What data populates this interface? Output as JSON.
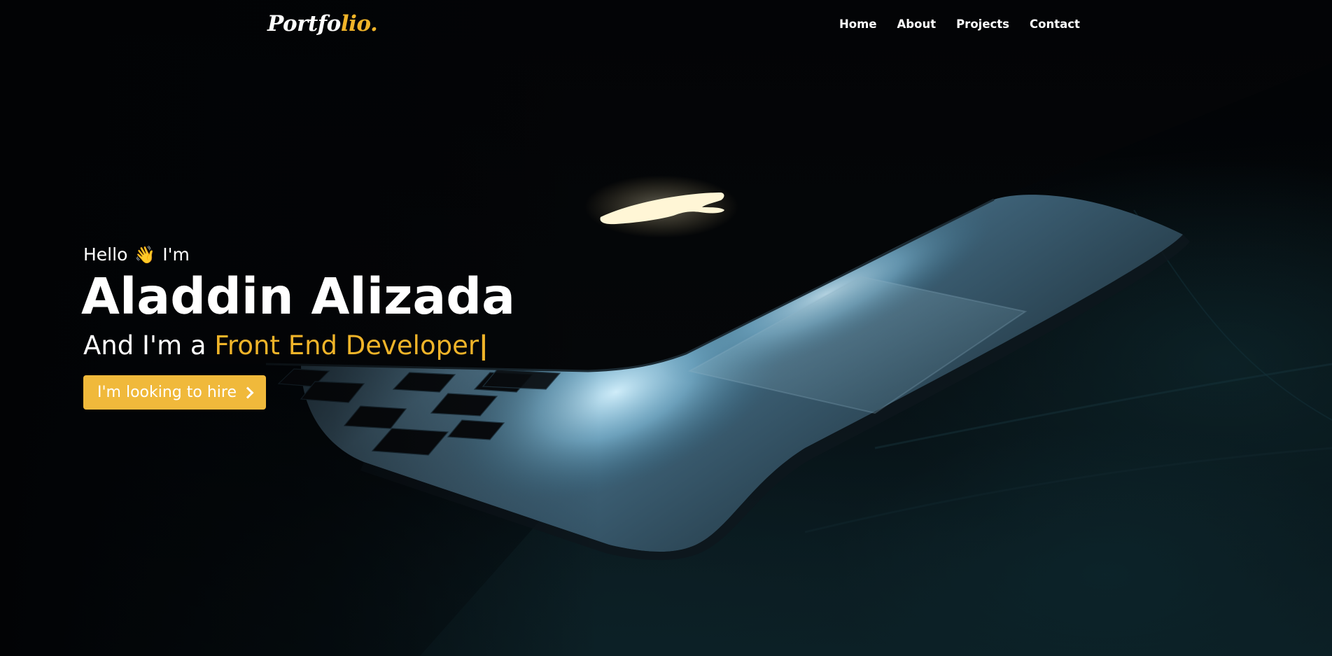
{
  "navbar": {
    "logo_main": "Portfo",
    "logo_accent": "lio.",
    "links": [
      "Home",
      "About",
      "Projects",
      "Contact"
    ]
  },
  "hero": {
    "greeting_before": "Hello",
    "wave_emoji": "👋",
    "greeting_after": "I'm",
    "name": "Aladdin Alizada",
    "role_prefix": "And I'm a ",
    "role": "Front End Developer",
    "cursor": "|",
    "cta_label": "I'm looking to hire",
    "cta_icon": "chevron-right-icon"
  },
  "colors": {
    "accent": "#f0b429",
    "button": "#f0b93b",
    "background": "#020305",
    "text": "#ffffff"
  }
}
